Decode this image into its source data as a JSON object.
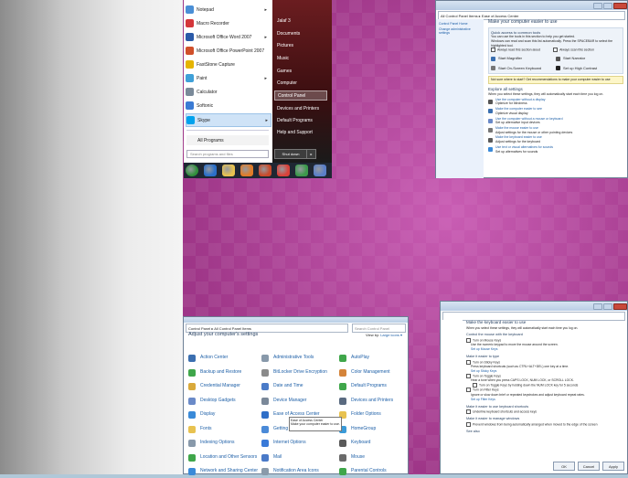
{
  "start_menu": {
    "programs": [
      {
        "label": "Notepad",
        "icon": "notepad-icon",
        "color": "#4a8fd6",
        "arrow": true
      },
      {
        "label": "Macro Recorder",
        "icon": "macro-recorder-icon",
        "color": "#d4363a",
        "arrow": false
      },
      {
        "label": "Microsoft Office Word 2007",
        "icon": "word-icon",
        "color": "#2a5aa8",
        "arrow": true
      },
      {
        "label": "Microsoft Office PowerPoint 2007",
        "icon": "powerpoint-icon",
        "color": "#d0502a",
        "arrow": false
      },
      {
        "label": "FastStone Capture",
        "icon": "faststone-icon",
        "color": "#e5b400",
        "arrow": false
      },
      {
        "label": "Paint",
        "icon": "paint-icon",
        "color": "#3fa0d8",
        "arrow": true
      },
      {
        "label": "Calculator",
        "icon": "calculator-icon",
        "color": "#7a8a99",
        "arrow": false
      },
      {
        "label": "Softonic",
        "icon": "softonic-icon",
        "color": "#3b7bd4",
        "arrow": false
      },
      {
        "label": "Skype",
        "icon": "skype-icon",
        "color": "#00a2ed",
        "arrow": true
      }
    ],
    "all_programs": "All Programs",
    "search_placeholder": "Search programs and files",
    "right_items": [
      "Jalaf 3",
      "Documents",
      "Pictures",
      "Music",
      "Games",
      "Computer",
      "Control Panel",
      "Devices and Printers",
      "Default Programs",
      "Help and Support"
    ],
    "shutdown": "Shut down",
    "taskbar_icons": [
      {
        "name": "start-orb-icon",
        "color": "#2f8f3a"
      },
      {
        "name": "internet-explorer-icon",
        "color": "#2a6fc9"
      },
      {
        "name": "folder-icon",
        "color": "#e8c250"
      },
      {
        "name": "media-player-icon",
        "color": "#e07b28"
      },
      {
        "name": "powerpoint-taskbar-icon",
        "color": "#c94a2a"
      },
      {
        "name": "chrome-icon",
        "color": "#d9423a"
      },
      {
        "name": "chrome-icon-2",
        "color": "#3c9a4b"
      },
      {
        "name": "control-panel-taskbar-icon",
        "color": "#5a7fc8"
      }
    ]
  },
  "ease": {
    "address": "All Control Panel Items ▸ Ease of Access Center",
    "side_links": [
      "Control Panel Home",
      "Change administrative settings"
    ],
    "title": "Make your computer easier to use",
    "quick_title": "Quick access to common tools",
    "quick_text": "You can use the tools in this section to help you get started.",
    "quick_text2": "Windows can read and scan this list automatically. Press the SPACEBAR to select the highlighted tool.",
    "always_read": "Always read this section aloud",
    "always_scan": "Always scan this section",
    "tools": [
      "Start Magnifier",
      "Start Narrator",
      "Start On-Screen Keyboard",
      "Set up High Contrast"
    ],
    "not_sure": "Not sure where to start? Get recommendations to make your computer easier to use",
    "explore_title": "Explore all settings",
    "explore_text": "When you select these settings, they will automatically start each time you log on.",
    "settings": [
      {
        "link": "Use the computer without a display",
        "desc": "Optimize for blindness"
      },
      {
        "link": "Make the computer easier to see",
        "desc": "Optimize visual display"
      },
      {
        "link": "Use the computer without a mouse or keyboard",
        "desc": "Set up alternative input devices"
      },
      {
        "link": "Make the mouse easier to use",
        "desc": "Adjust settings for the mouse or other pointing devices"
      },
      {
        "link": "Make the keyboard easier to use",
        "desc": "Adjust settings for the keyboard"
      },
      {
        "link": "Use text or visual alternatives for sounds",
        "desc": "Set up alternatives for sounds"
      }
    ]
  },
  "cp": {
    "address": "Control Panel ▸ All Control Panel Items",
    "search": "Search Control Panel",
    "heading": "Adjust your computer's settings",
    "view_by_label": "View by:",
    "view_by_value": "Large icons ▾",
    "items": [
      {
        "label": "Action Center",
        "icon": "action-center-icon",
        "color": "#3b6fb0"
      },
      {
        "label": "Administrative Tools",
        "icon": "admin-tools-icon",
        "color": "#8899aa"
      },
      {
        "label": "AutoPlay",
        "icon": "autoplay-icon",
        "color": "#3fa64a"
      },
      {
        "label": "Backup and Restore",
        "icon": "backup-icon",
        "color": "#3fa64a"
      },
      {
        "label": "BitLocker Drive Encryption",
        "icon": "bitlocker-icon",
        "color": "#8a8a8a"
      },
      {
        "label": "Color Management",
        "icon": "color-management-icon",
        "color": "#d4843a"
      },
      {
        "label": "Credential Manager",
        "icon": "credential-manager-icon",
        "color": "#d9a93a"
      },
      {
        "label": "Date and Time",
        "icon": "date-time-icon",
        "color": "#4a7bc8"
      },
      {
        "label": "Default Programs",
        "icon": "default-programs-icon",
        "color": "#3fa64a"
      },
      {
        "label": "Desktop Gadgets",
        "icon": "gadgets-icon",
        "color": "#6a8ac8"
      },
      {
        "label": "Device Manager",
        "icon": "device-manager-icon",
        "color": "#7a8899"
      },
      {
        "label": "Devices and Printers",
        "icon": "printer-icon",
        "color": "#5a6a80"
      },
      {
        "label": "Display",
        "icon": "display-icon",
        "color": "#3a8ad8"
      },
      {
        "label": "Ease of Access Center",
        "icon": "ease-of-access-icon",
        "color": "#2f6fc8"
      },
      {
        "label": "Folder Options",
        "icon": "folder-options-icon",
        "color": "#e8c250"
      },
      {
        "label": "Fonts",
        "icon": "fonts-icon",
        "color": "#e8c250"
      },
      {
        "label": "Getting Started",
        "icon": "getting-started-icon",
        "color": "#4a8ad8"
      },
      {
        "label": "HomeGroup",
        "icon": "homegroup-icon",
        "color": "#3a9ad8"
      },
      {
        "label": "Indexing Options",
        "icon": "indexing-icon",
        "color": "#8899aa"
      },
      {
        "label": "Internet Options",
        "icon": "internet-options-icon",
        "color": "#3a7ad8"
      },
      {
        "label": "Keyboard",
        "icon": "keyboard-icon",
        "color": "#5a5a5a"
      },
      {
        "label": "Location and Other Sensors",
        "icon": "location-icon",
        "color": "#3fa64a"
      },
      {
        "label": "Mail",
        "icon": "mail-icon",
        "color": "#4a7ac8"
      },
      {
        "label": "Mouse",
        "icon": "mouse-icon",
        "color": "#6a6a6a"
      },
      {
        "label": "Network and Sharing Center",
        "icon": "network-icon",
        "color": "#3a8ad8"
      },
      {
        "label": "Notification Area Icons",
        "icon": "notification-icon",
        "color": "#8a9aaa"
      },
      {
        "label": "Parental Controls",
        "icon": "parental-controls-icon",
        "color": "#3fa64a"
      }
    ],
    "tooltip_title": "Ease of Access Center",
    "tooltip_text": "Make your computer easier to use."
  },
  "kb": {
    "title": "Make the keyboard easier to use",
    "subtitle": "When you select these settings, they will automatically start each time you log on.",
    "s1": "Control the mouse with the keyboard",
    "mouse_keys": "Turn on Mouse Keys",
    "mouse_keys_desc": "Use the numeric keypad to move the mouse around the screen.",
    "mouse_keys_link": "Set up Mouse Keys",
    "s2": "Make it easier to type",
    "sticky": "Turn on Sticky Keys",
    "sticky_desc": "Press keyboard shortcuts (such as CTRL+ALT+DEL) one key at a time.",
    "sticky_link": "Set up Sticky Keys",
    "toggle": "Turn on Toggle Keys",
    "toggle_desc": "Hear a tone when you press CAPS LOCK, NUM LOCK, or SCROLL LOCK.",
    "toggle_sub": "Turn on Toggle Keys by holding down the NUM LOCK key for 5 seconds",
    "filter": "Turn on Filter Keys",
    "filter_desc": "Ignore or slow down brief or repeated keystrokes and adjust keyboard repeat rates.",
    "filter_link": "Set up Filter Keys",
    "s3": "Make it easier to use keyboard shortcuts",
    "underline": "Underline keyboard shortcuts and access keys",
    "s4": "Make it easier to manage windows",
    "prevent": "Prevent windows from being automatically arranged when moved to the edge of the screen",
    "see_also": "See also",
    "ok": "OK",
    "cancel": "Cancel",
    "apply": "Apply"
  }
}
